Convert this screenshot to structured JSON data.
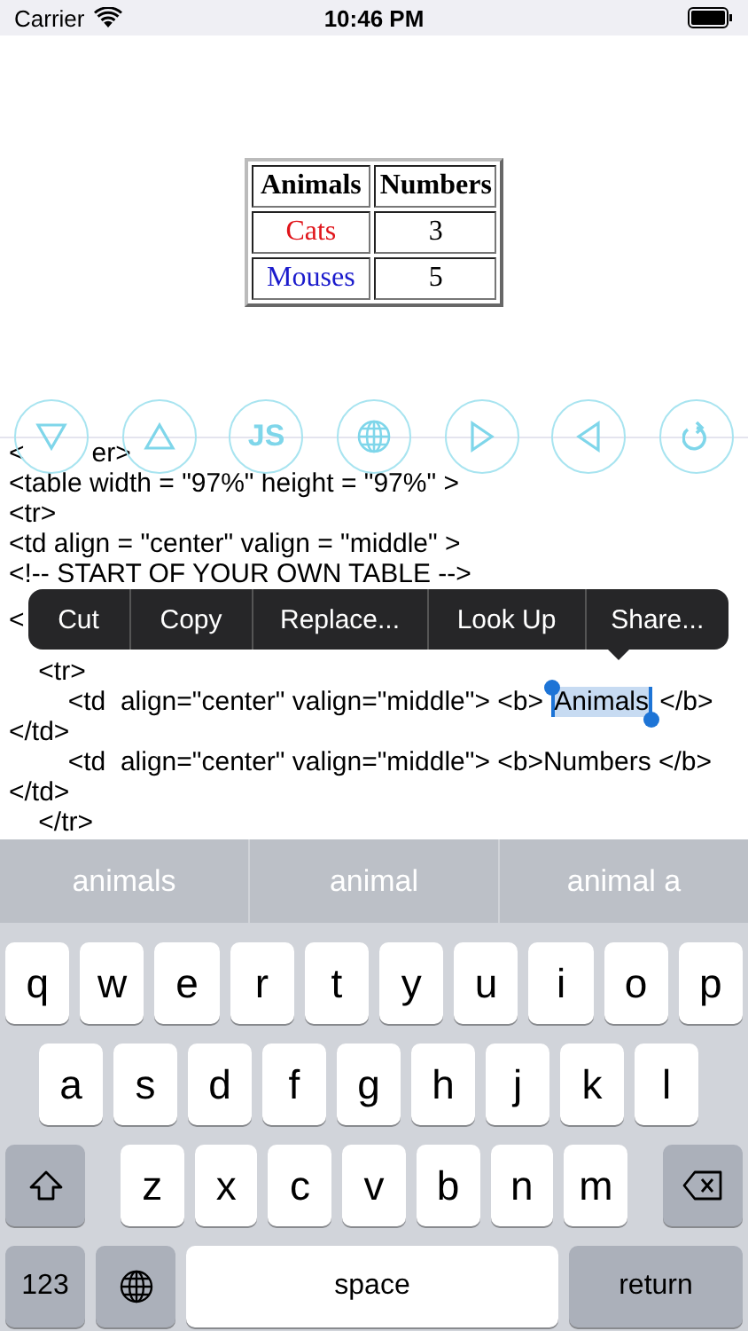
{
  "status_bar": {
    "carrier": "Carrier",
    "time": "10:46 PM"
  },
  "preview_table": {
    "columns": [
      "Animals",
      "Numbers"
    ],
    "rows": [
      {
        "name": "Cats",
        "color": "#e0151b",
        "value": "3"
      },
      {
        "name": "Mouses",
        "color": "#1a1acc",
        "value": "5"
      }
    ]
  },
  "toolbar": [
    {
      "kind": "down"
    },
    {
      "kind": "up"
    },
    {
      "kind": "text",
      "label": "JS"
    },
    {
      "kind": "globe"
    },
    {
      "kind": "right"
    },
    {
      "kind": "left"
    },
    {
      "kind": "refresh"
    }
  ],
  "code_above": [
    [
      {
        "text": "<",
        "selected": false
      },
      {
        "text": "er>",
        "selected": false
      }
    ],
    [
      {
        "text": "<table width = \"97%\" height = \"97%\" >",
        "selected": false
      }
    ],
    [
      {
        "text": "<tr>",
        "selected": false
      }
    ],
    [
      {
        "text": "<td align = \"center\" valign = \"middle\" >",
        "selected": false
      }
    ],
    [
      {
        "text": "<!-- START OF YOUR OWN TABLE -->",
        "selected": false
      }
    ]
  ],
  "menu_row": {
    "code": "<",
    "items": [
      "Cut",
      "Copy",
      "Replace...",
      "Look Up",
      "Share..."
    ]
  },
  "code_below": [
    [
      {
        "text": "    <tr>",
        "selected": false
      }
    ],
    [
      {
        "text": "        <td  align=\"center\" valign=\"middle\"> <b> ",
        "selected": false
      },
      {
        "text": "Animals",
        "selected": true
      },
      {
        "text": " </b>",
        "selected": false
      }
    ],
    [
      {
        "text": "</td>",
        "selected": false
      }
    ],
    [
      {
        "text": "        <td  align=\"center\" valign=\"middle\"> <b>Numbers </b>",
        "selected": false
      }
    ],
    [
      {
        "text": "</td>",
        "selected": false
      }
    ],
    [
      {
        "text": "    </tr>",
        "selected": false
      }
    ]
  ],
  "suggestions": [
    "animals",
    "animal",
    "animal a"
  ],
  "keyboard": {
    "rows": [
      [
        "q",
        "w",
        "e",
        "r",
        "t",
        "y",
        "u",
        "i",
        "o",
        "p"
      ],
      [
        "a",
        "s",
        "d",
        "f",
        "g",
        "h",
        "j",
        "k",
        "l"
      ],
      [
        "z",
        "x",
        "c",
        "v",
        "b",
        "n",
        "m"
      ]
    ],
    "numbers_key": "123",
    "space_key": "space",
    "return_key": "return"
  }
}
